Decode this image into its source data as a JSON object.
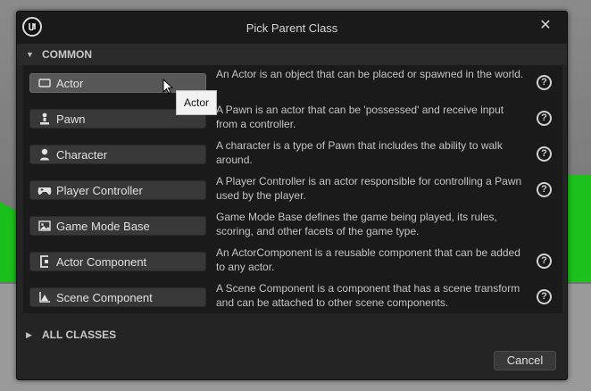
{
  "dialog": {
    "title": "Pick Parent Class",
    "close_glyph": "✕",
    "logo_icon": "unreal-logo-icon"
  },
  "common_section": {
    "label": "COMMON",
    "expanded": true
  },
  "classes": [
    {
      "name": "Actor",
      "icon": "actor-icon",
      "description": "An Actor is an object that can be placed or spawned in the world.",
      "hovered": true,
      "has_help": true
    },
    {
      "name": "Pawn",
      "icon": "pawn-icon",
      "description": "A Pawn is an actor that can be 'possessed' and receive input from a controller.",
      "has_help": true
    },
    {
      "name": "Character",
      "icon": "character-icon",
      "description": "A character is a type of Pawn that includes the ability to walk around.",
      "has_help": true
    },
    {
      "name": "Player Controller",
      "icon": "gamepad-icon",
      "description": "A Player Controller is an actor responsible for controlling a Pawn used by the player.",
      "has_help": true
    },
    {
      "name": "Game Mode Base",
      "icon": "game-mode-icon",
      "description": "Game Mode Base defines the game being played, its rules, scoring, and other facets of the game type.",
      "has_help": false
    },
    {
      "name": "Actor Component",
      "icon": "actor-component-icon",
      "description": "An ActorComponent is a reusable component that can be added to any actor.",
      "has_help": true
    },
    {
      "name": "Scene Component",
      "icon": "scene-component-icon",
      "description": "A Scene Component is a component that has a scene transform and can be attached to other scene components.",
      "has_help": true
    }
  ],
  "help_glyph": "?",
  "tooltip": {
    "text": "Actor"
  },
  "all_classes_section": {
    "label": "ALL CLASSES",
    "expanded": false
  },
  "footer": {
    "cancel_label": "Cancel"
  }
}
